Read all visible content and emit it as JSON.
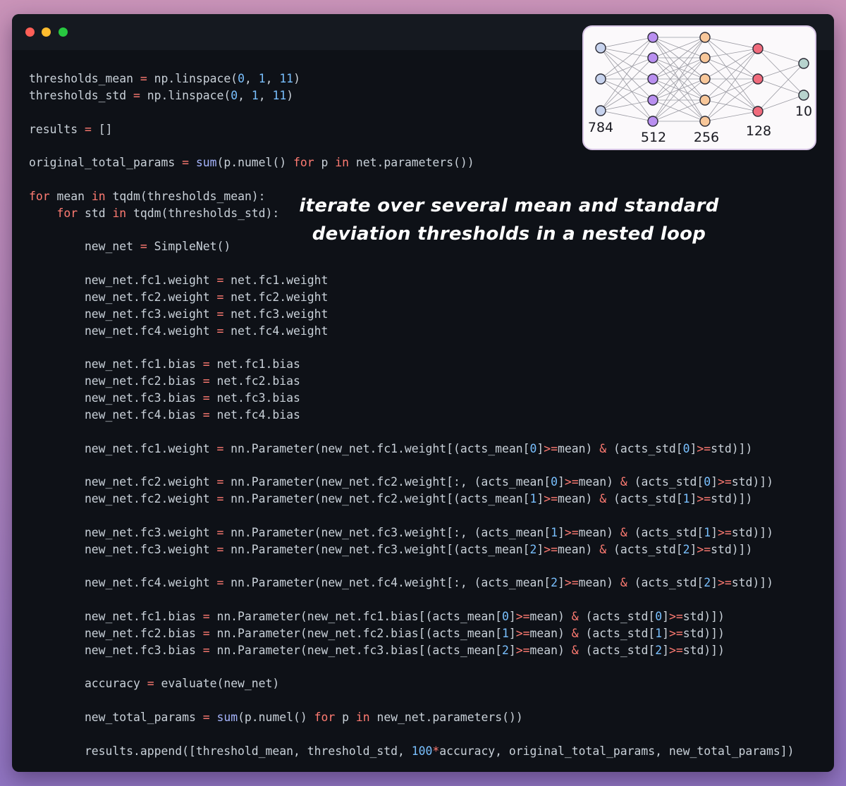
{
  "window": {
    "controls": [
      "close",
      "minimize",
      "maximize"
    ]
  },
  "code_lines": [
    [
      [
        "plain",
        "thresholds_mean "
      ],
      [
        "op",
        "="
      ],
      [
        "plain",
        " np.linspace("
      ],
      [
        "num",
        "0"
      ],
      [
        "plain",
        ", "
      ],
      [
        "num",
        "1"
      ],
      [
        "plain",
        ", "
      ],
      [
        "num",
        "11"
      ],
      [
        "plain",
        ")"
      ]
    ],
    [
      [
        "plain",
        "thresholds_std "
      ],
      [
        "op",
        "="
      ],
      [
        "plain",
        " np.linspace("
      ],
      [
        "num",
        "0"
      ],
      [
        "plain",
        ", "
      ],
      [
        "num",
        "1"
      ],
      [
        "plain",
        ", "
      ],
      [
        "num",
        "11"
      ],
      [
        "plain",
        ")"
      ]
    ],
    [],
    [
      [
        "plain",
        "results "
      ],
      [
        "op",
        "="
      ],
      [
        "plain",
        " []"
      ]
    ],
    [],
    [
      [
        "plain",
        "original_total_params "
      ],
      [
        "op",
        "="
      ],
      [
        "plain",
        " "
      ],
      [
        "fn",
        "sum"
      ],
      [
        "plain",
        "(p.numel() "
      ],
      [
        "kw",
        "for"
      ],
      [
        "plain",
        " p "
      ],
      [
        "kw",
        "in"
      ],
      [
        "plain",
        " net.parameters())"
      ]
    ],
    [],
    [
      [
        "kw",
        "for"
      ],
      [
        "plain",
        " mean "
      ],
      [
        "kw",
        "in"
      ],
      [
        "plain",
        " tqdm(thresholds_mean):"
      ]
    ],
    [
      [
        "plain",
        "    "
      ],
      [
        "kw",
        "for"
      ],
      [
        "plain",
        " std "
      ],
      [
        "kw",
        "in"
      ],
      [
        "plain",
        " tqdm(thresholds_std):"
      ]
    ],
    [],
    [
      [
        "plain",
        "        new_net "
      ],
      [
        "op",
        "="
      ],
      [
        "plain",
        " SimpleNet()"
      ]
    ],
    [],
    [
      [
        "plain",
        "        new_net.fc1.weight "
      ],
      [
        "op",
        "="
      ],
      [
        "plain",
        " net.fc1.weight"
      ]
    ],
    [
      [
        "plain",
        "        new_net.fc2.weight "
      ],
      [
        "op",
        "="
      ],
      [
        "plain",
        " net.fc2.weight"
      ]
    ],
    [
      [
        "plain",
        "        new_net.fc3.weight "
      ],
      [
        "op",
        "="
      ],
      [
        "plain",
        " net.fc3.weight"
      ]
    ],
    [
      [
        "plain",
        "        new_net.fc4.weight "
      ],
      [
        "op",
        "="
      ],
      [
        "plain",
        " net.fc4.weight"
      ]
    ],
    [],
    [
      [
        "plain",
        "        new_net.fc1.bias "
      ],
      [
        "op",
        "="
      ],
      [
        "plain",
        " net.fc1.bias"
      ]
    ],
    [
      [
        "plain",
        "        new_net.fc2.bias "
      ],
      [
        "op",
        "="
      ],
      [
        "plain",
        " net.fc2.bias"
      ]
    ],
    [
      [
        "plain",
        "        new_net.fc3.bias "
      ],
      [
        "op",
        "="
      ],
      [
        "plain",
        " net.fc3.bias"
      ]
    ],
    [
      [
        "plain",
        "        new_net.fc4.bias "
      ],
      [
        "op",
        "="
      ],
      [
        "plain",
        " net.fc4.bias"
      ]
    ],
    [],
    [
      [
        "plain",
        "        new_net.fc1.weight "
      ],
      [
        "op",
        "="
      ],
      [
        "plain",
        " nn.Parameter(new_net.fc1.weight[(acts_mean["
      ],
      [
        "num",
        "0"
      ],
      [
        "plain",
        "]"
      ],
      [
        "op",
        ">="
      ],
      [
        "plain",
        "mean) "
      ],
      [
        "op",
        "&"
      ],
      [
        "plain",
        " (acts_std["
      ],
      [
        "num",
        "0"
      ],
      [
        "plain",
        "]"
      ],
      [
        "op",
        ">="
      ],
      [
        "plain",
        "std)])"
      ]
    ],
    [],
    [
      [
        "plain",
        "        new_net.fc2.weight "
      ],
      [
        "op",
        "="
      ],
      [
        "plain",
        " nn.Parameter(new_net.fc2.weight[:, (acts_mean["
      ],
      [
        "num",
        "0"
      ],
      [
        "plain",
        "]"
      ],
      [
        "op",
        ">="
      ],
      [
        "plain",
        "mean) "
      ],
      [
        "op",
        "&"
      ],
      [
        "plain",
        " (acts_std["
      ],
      [
        "num",
        "0"
      ],
      [
        "plain",
        "]"
      ],
      [
        "op",
        ">="
      ],
      [
        "plain",
        "std)])"
      ]
    ],
    [
      [
        "plain",
        "        new_net.fc2.weight "
      ],
      [
        "op",
        "="
      ],
      [
        "plain",
        " nn.Parameter(new_net.fc2.weight[(acts_mean["
      ],
      [
        "num",
        "1"
      ],
      [
        "plain",
        "]"
      ],
      [
        "op",
        ">="
      ],
      [
        "plain",
        "mean) "
      ],
      [
        "op",
        "&"
      ],
      [
        "plain",
        " (acts_std["
      ],
      [
        "num",
        "1"
      ],
      [
        "plain",
        "]"
      ],
      [
        "op",
        ">="
      ],
      [
        "plain",
        "std)])"
      ]
    ],
    [],
    [
      [
        "plain",
        "        new_net.fc3.weight "
      ],
      [
        "op",
        "="
      ],
      [
        "plain",
        " nn.Parameter(new_net.fc3.weight[:, (acts_mean["
      ],
      [
        "num",
        "1"
      ],
      [
        "plain",
        "]"
      ],
      [
        "op",
        ">="
      ],
      [
        "plain",
        "mean) "
      ],
      [
        "op",
        "&"
      ],
      [
        "plain",
        " (acts_std["
      ],
      [
        "num",
        "1"
      ],
      [
        "plain",
        "]"
      ],
      [
        "op",
        ">="
      ],
      [
        "plain",
        "std)])"
      ]
    ],
    [
      [
        "plain",
        "        new_net.fc3.weight "
      ],
      [
        "op",
        "="
      ],
      [
        "plain",
        " nn.Parameter(new_net.fc3.weight[(acts_mean["
      ],
      [
        "num",
        "2"
      ],
      [
        "plain",
        "]"
      ],
      [
        "op",
        ">="
      ],
      [
        "plain",
        "mean) "
      ],
      [
        "op",
        "&"
      ],
      [
        "plain",
        " (acts_std["
      ],
      [
        "num",
        "2"
      ],
      [
        "plain",
        "]"
      ],
      [
        "op",
        ">="
      ],
      [
        "plain",
        "std)])"
      ]
    ],
    [],
    [
      [
        "plain",
        "        new_net.fc4.weight "
      ],
      [
        "op",
        "="
      ],
      [
        "plain",
        " nn.Parameter(new_net.fc4.weight[:, (acts_mean["
      ],
      [
        "num",
        "2"
      ],
      [
        "plain",
        "]"
      ],
      [
        "op",
        ">="
      ],
      [
        "plain",
        "mean) "
      ],
      [
        "op",
        "&"
      ],
      [
        "plain",
        " (acts_std["
      ],
      [
        "num",
        "2"
      ],
      [
        "plain",
        "]"
      ],
      [
        "op",
        ">="
      ],
      [
        "plain",
        "std)])"
      ]
    ],
    [],
    [
      [
        "plain",
        "        new_net.fc1.bias "
      ],
      [
        "op",
        "="
      ],
      [
        "plain",
        " nn.Parameter(new_net.fc1.bias[(acts_mean["
      ],
      [
        "num",
        "0"
      ],
      [
        "plain",
        "]"
      ],
      [
        "op",
        ">="
      ],
      [
        "plain",
        "mean) "
      ],
      [
        "op",
        "&"
      ],
      [
        "plain",
        " (acts_std["
      ],
      [
        "num",
        "0"
      ],
      [
        "plain",
        "]"
      ],
      [
        "op",
        ">="
      ],
      [
        "plain",
        "std)])"
      ]
    ],
    [
      [
        "plain",
        "        new_net.fc2.bias "
      ],
      [
        "op",
        "="
      ],
      [
        "plain",
        " nn.Parameter(new_net.fc2.bias[(acts_mean["
      ],
      [
        "num",
        "1"
      ],
      [
        "plain",
        "]"
      ],
      [
        "op",
        ">="
      ],
      [
        "plain",
        "mean) "
      ],
      [
        "op",
        "&"
      ],
      [
        "plain",
        " (acts_std["
      ],
      [
        "num",
        "1"
      ],
      [
        "plain",
        "]"
      ],
      [
        "op",
        ">="
      ],
      [
        "plain",
        "std)])"
      ]
    ],
    [
      [
        "plain",
        "        new_net.fc3.bias "
      ],
      [
        "op",
        "="
      ],
      [
        "plain",
        " nn.Parameter(new_net.fc3.bias[(acts_mean["
      ],
      [
        "num",
        "2"
      ],
      [
        "plain",
        "]"
      ],
      [
        "op",
        ">="
      ],
      [
        "plain",
        "mean) "
      ],
      [
        "op",
        "&"
      ],
      [
        "plain",
        " (acts_std["
      ],
      [
        "num",
        "2"
      ],
      [
        "plain",
        "]"
      ],
      [
        "op",
        ">="
      ],
      [
        "plain",
        "std)])"
      ]
    ],
    [],
    [
      [
        "plain",
        "        accuracy "
      ],
      [
        "op",
        "="
      ],
      [
        "plain",
        " evaluate(new_net)"
      ]
    ],
    [],
    [
      [
        "plain",
        "        new_total_params "
      ],
      [
        "op",
        "="
      ],
      [
        "plain",
        " "
      ],
      [
        "fn",
        "sum"
      ],
      [
        "plain",
        "(p.numel() "
      ],
      [
        "kw",
        "for"
      ],
      [
        "plain",
        " p "
      ],
      [
        "kw",
        "in"
      ],
      [
        "plain",
        " new_net.parameters())"
      ]
    ],
    [],
    [
      [
        "plain",
        "        results.append([threshold_mean, threshold_std, "
      ],
      [
        "num",
        "100"
      ],
      [
        "op",
        "*"
      ],
      [
        "plain",
        "accuracy, original_total_params, new_total_params])"
      ]
    ]
  ],
  "annotation": {
    "line1": "iterate over several mean and standard",
    "line2": "deviation thresholds in a nested loop"
  },
  "network_diagram": {
    "layers": [
      {
        "label": "784",
        "nodes": 3,
        "color": "#c7d3ee"
      },
      {
        "label": "512",
        "nodes": 5,
        "color": "#b98ff0"
      },
      {
        "label": "256",
        "nodes": 5,
        "color": "#f8c79a"
      },
      {
        "label": "128",
        "nodes": 3,
        "color": "#f06b7c"
      },
      {
        "label": "10",
        "nodes": 2,
        "color": "#b7d3ce"
      }
    ]
  }
}
